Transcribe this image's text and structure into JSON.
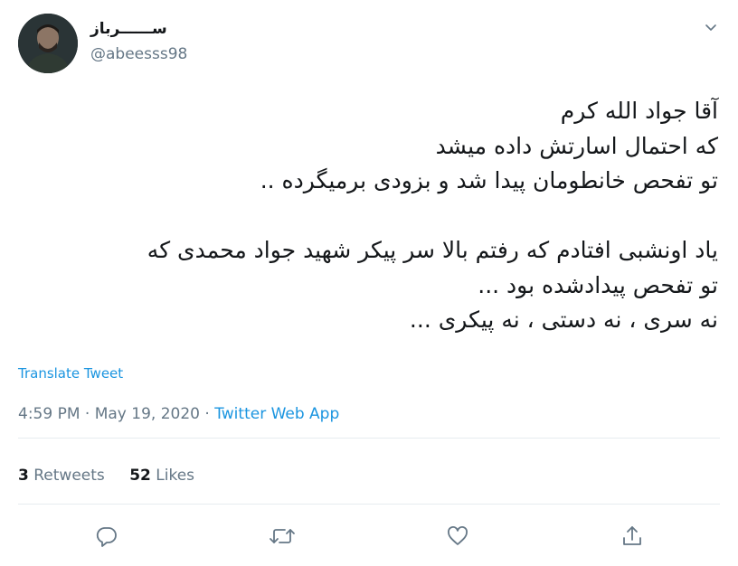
{
  "author": {
    "display_name": "ســــــرباز",
    "username": "@abeesss98"
  },
  "tweet": {
    "lines": [
      "آقا جواد الله کرم",
      "که احتمال اسارتش داده میشد",
      "تو تفحص خانطومان پیدا شد و بزودی برمیگرده ..",
      "",
      "یاد اونشبی افتادم که رفتم بالا سر پیکر شهید جواد محمدی که",
      "تو تفحص پیدادشده بود ...",
      "نه سری ، نه دستی ، نه پیکری ..."
    ]
  },
  "translate_label": "Translate Tweet",
  "meta": {
    "time": "4:59 PM",
    "separator": "·",
    "date": "May 19, 2020",
    "source": "Twitter Web App"
  },
  "stats": {
    "retweets_count": "3",
    "retweets_label": "Retweets",
    "likes_count": "52",
    "likes_label": "Likes"
  },
  "icons": {
    "caret": "chevron-down-icon",
    "reply": "reply-icon",
    "retweet": "retweet-icon",
    "like": "heart-icon",
    "share": "share-icon"
  },
  "colors": {
    "link": "#1b95e0",
    "secondary_text": "#657786",
    "primary_text": "#14171a",
    "divider": "#e6ecf0"
  }
}
